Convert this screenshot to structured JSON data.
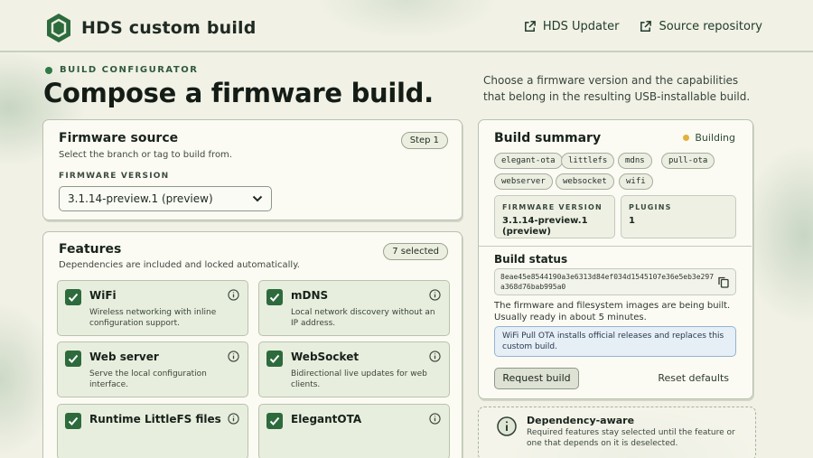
{
  "header": {
    "title": "HDS custom build",
    "links": [
      {
        "label": "HDS Updater",
        "icon": "external-link-icon"
      },
      {
        "label": "Source repository",
        "icon": "external-link-icon"
      }
    ]
  },
  "hero": {
    "eyebrow": "BUILD CONFIGURATOR",
    "title": "Compose a firmware build.",
    "description": "Choose a firmware version and the capabilities that belong in the resulting USB-installable build."
  },
  "source": {
    "title": "Firmware source",
    "subtitle": "Select the branch or tag to build from.",
    "step": "Step 1",
    "field_label": "FIRMWARE VERSION",
    "selected": "3.1.14-preview.1 (preview)"
  },
  "features": {
    "title": "Features",
    "subtitle": "Dependencies are included and locked automatically.",
    "count": "7 selected",
    "items": [
      {
        "name": "WiFi",
        "desc": "Wireless networking with inline configuration support.",
        "checked": true
      },
      {
        "name": "mDNS",
        "desc": "Local network discovery without an IP address.",
        "checked": true
      },
      {
        "name": "Web server",
        "desc": "Serve the local configuration interface.",
        "checked": true
      },
      {
        "name": "WebSocket",
        "desc": "Bidirectional live updates for web clients.",
        "checked": true
      },
      {
        "name": "Runtime LittleFS files",
        "desc": "",
        "checked": true
      },
      {
        "name": "ElegantOTA",
        "desc": "",
        "checked": true
      }
    ]
  },
  "summary": {
    "title": "Build summary",
    "status": "Building",
    "status_color": "#e0b23a",
    "chips": [
      "elegant-ota",
      "littlefs",
      "mdns",
      "pull-ota",
      "webserver",
      "websocket",
      "wifi"
    ],
    "firmware_label": "FIRMWARE VERSION",
    "firmware_value": "3.1.14-preview.1 (preview)",
    "plugins_label": "PLUGINS",
    "plugins_value": "1"
  },
  "build": {
    "title": "Build status",
    "hash": "8eae45e8544190a3e6313d84ef034d1545107e36e5eb3e297a368d76bab995a0",
    "message": "The firmware and filesystem images are being built. Usually ready in about 5 minutes.",
    "note": "WiFi Pull OTA installs official releases and replaces this custom build.",
    "request_label": "Request build",
    "reset_label": "Reset defaults"
  },
  "dependency": {
    "title": "Dependency-aware",
    "desc": "Required features stay selected until the feature or one that depends on it is deselected."
  },
  "colors": {
    "accent": "#2d6b3d",
    "info_bg": "#e6eef6"
  }
}
